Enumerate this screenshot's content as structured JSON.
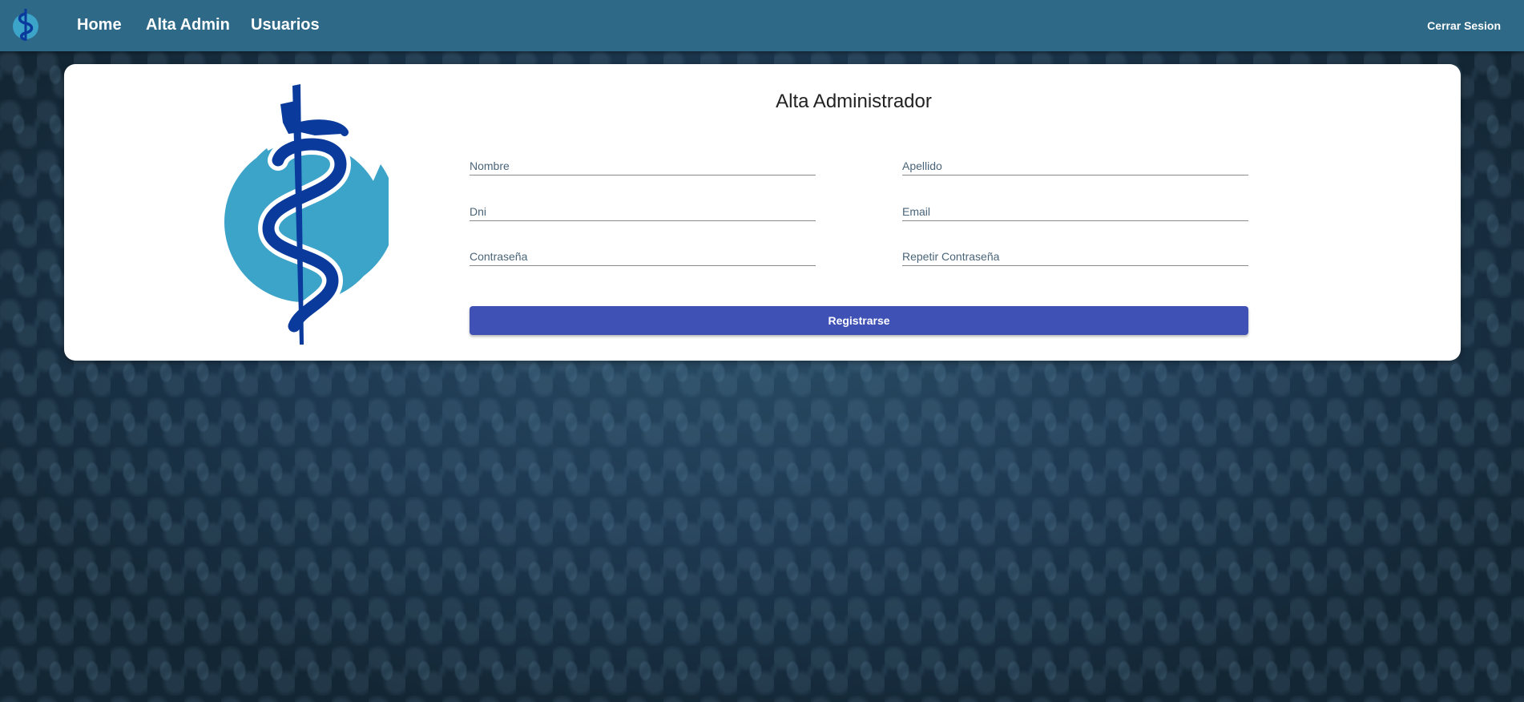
{
  "navbar": {
    "logo_icon": "caduceus-logo-icon",
    "links": [
      "Home",
      "Alta Admin",
      "Usuarios"
    ],
    "logout_label": "Cerrar Sesion"
  },
  "form": {
    "title": "Alta Administrador",
    "logo_icon": "rod-of-asclepius-logo",
    "fields": {
      "nombre": "Nombre",
      "apellido": "Apellido",
      "dni": "Dni",
      "email": "Email",
      "password": "Contraseña",
      "repeat_password": "Repetir Contraseña"
    },
    "submit_label": "Registrarse"
  },
  "colors": {
    "navbar": "#2e6a87",
    "button": "#3f51b5",
    "logo_circle": "#3ca3c9",
    "logo_snake": "#0a3b9c"
  }
}
